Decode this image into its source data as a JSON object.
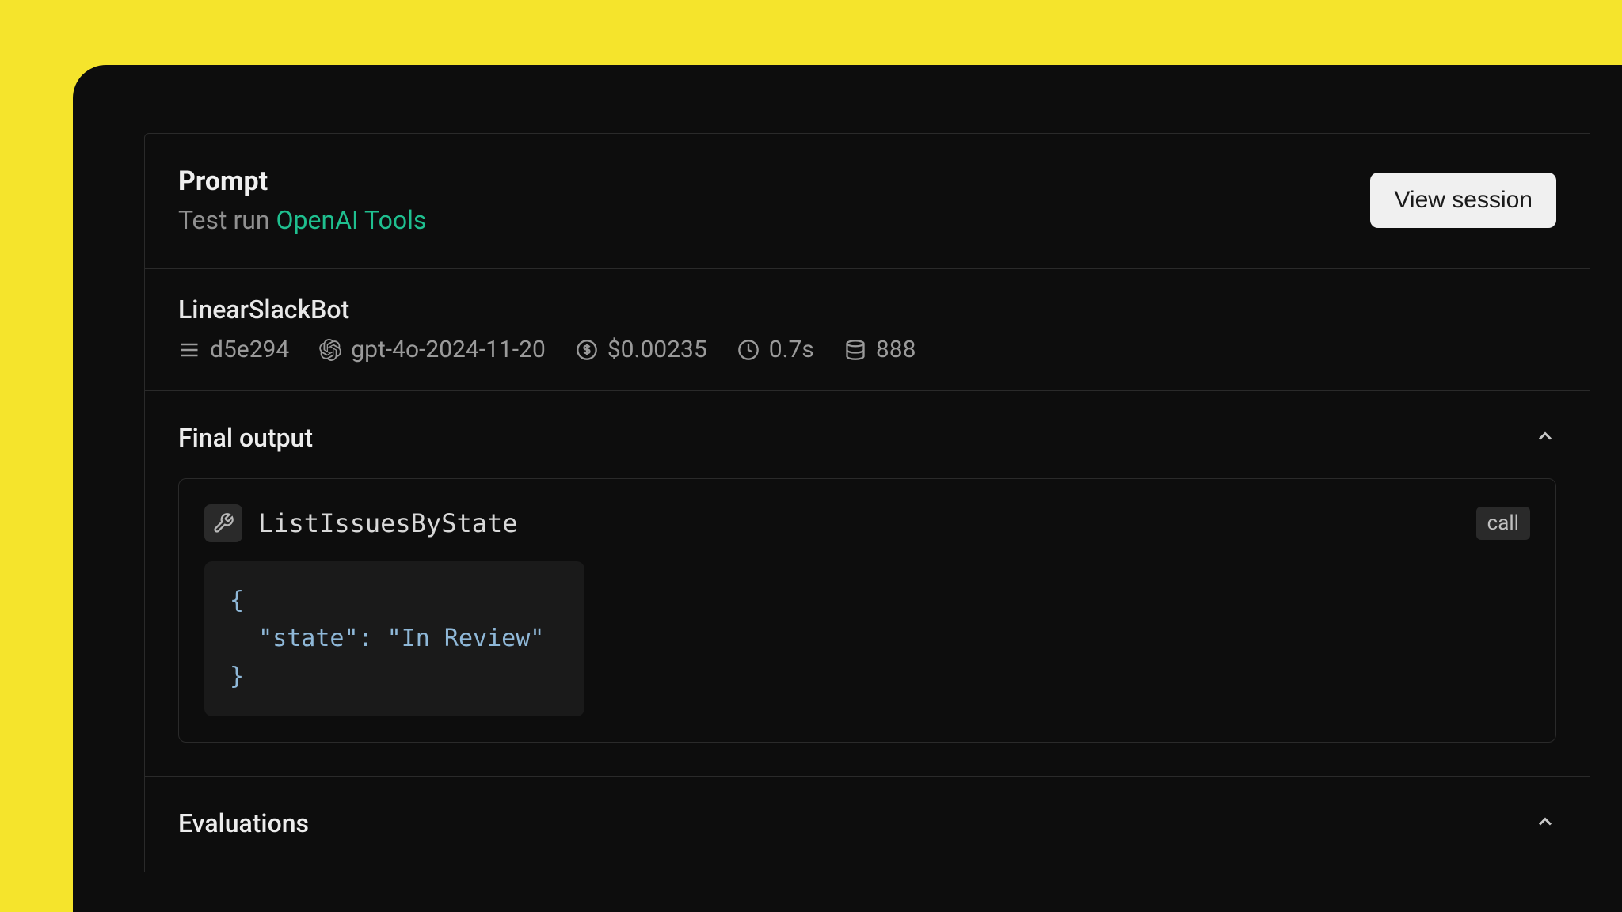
{
  "header": {
    "title": "Prompt",
    "subtitle_prefix": "Test run ",
    "subtitle_link": "OpenAI Tools",
    "button_label": "View session"
  },
  "meta": {
    "run_name": "LinearSlackBot",
    "commit": "d5e294",
    "model": "gpt-4o-2024-11-20",
    "cost": "$0.00235",
    "duration": "0.7s",
    "tokens": "888"
  },
  "output": {
    "section_title": "Final output",
    "tool_name": "ListIssuesByState",
    "call_badge": "call",
    "code": "{\n  \"state\": \"In Review\"\n}"
  },
  "evaluations": {
    "section_title": "Evaluations"
  }
}
